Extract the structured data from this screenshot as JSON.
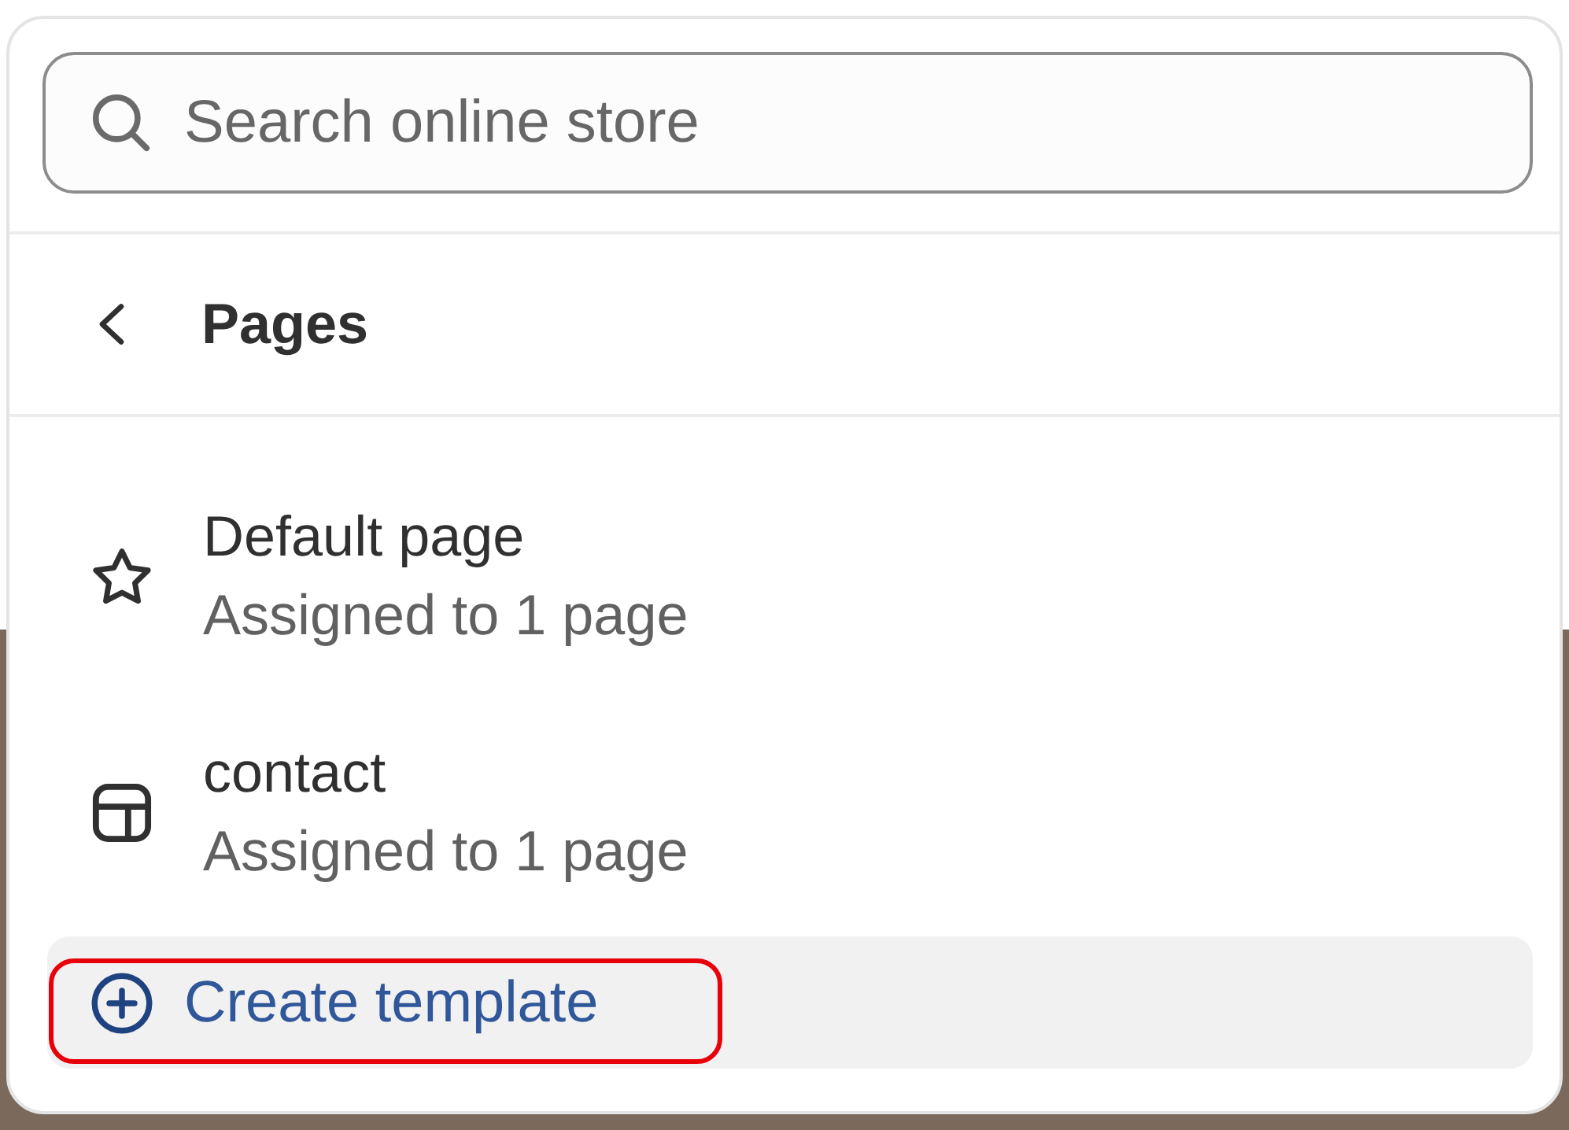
{
  "search": {
    "placeholder": "Search online store"
  },
  "header": {
    "title": "Pages"
  },
  "templates": [
    {
      "kind": "default",
      "name": "Default page",
      "detail": "Assigned to 1 page"
    },
    {
      "kind": "custom",
      "name": "contact",
      "detail": "Assigned to 1 page"
    }
  ],
  "create_template": {
    "label": "Create template",
    "highlighted": true
  }
}
